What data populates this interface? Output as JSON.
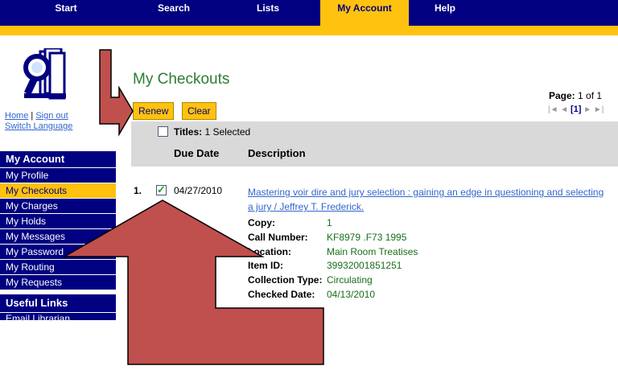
{
  "topnav": {
    "tabs": [
      {
        "label": "Start",
        "active": false
      },
      {
        "label": "Search",
        "active": false
      },
      {
        "label": "Lists",
        "active": false
      },
      {
        "label": "My Account",
        "active": true
      },
      {
        "label": "Help",
        "active": false
      }
    ]
  },
  "toplinks": {
    "home": "Home",
    "sign_out": "Sign out",
    "separator": "|",
    "switch_language": "Switch Language"
  },
  "sidebar": {
    "heading": "My Account",
    "items": [
      {
        "label": "My Profile",
        "active": false
      },
      {
        "label": "My Checkouts",
        "active": true
      },
      {
        "label": "My Charges",
        "active": false
      },
      {
        "label": "My Holds",
        "active": false
      },
      {
        "label": "My Messages",
        "active": false
      },
      {
        "label": "My Password",
        "active": false
      },
      {
        "label": "My Routing",
        "active": false
      },
      {
        "label": "My Requests",
        "active": false
      }
    ],
    "heading2": "Useful Links",
    "links": [
      {
        "label": "Email Librarian"
      }
    ]
  },
  "main": {
    "title": "My Checkouts",
    "renew_label": "Renew",
    "clear_label": "Clear",
    "page_label": "Page:",
    "page_value": "1 of 1",
    "pager_current": "[1]",
    "titles_label": "Titles:",
    "titles_selected": "1 Selected",
    "col_due": "Due Date",
    "col_desc": "Description"
  },
  "checkouts": [
    {
      "num": "1.",
      "checked": true,
      "due_date": "04/27/2010",
      "description": "Mastering voir dire and jury selection : gaining an edge in questioning and selecting a jury / Jeffrey T. Frederick.",
      "details": [
        {
          "key": "Copy:",
          "value": "1"
        },
        {
          "key": "Call Number:",
          "value": "KF8979 .F73 1995"
        },
        {
          "key": "Location:",
          "value": "Main Room Treatises"
        },
        {
          "key": "Item ID:",
          "value": "39932001851251"
        },
        {
          "key": "Collection Type:",
          "value": "Circulating"
        },
        {
          "key": "Checked Date:",
          "value": "04/13/2010"
        }
      ]
    }
  ],
  "colors": {
    "nav_blue": "#000080",
    "gold": "#ffc20e",
    "title_green": "#2e7d32",
    "link_blue": "#3366cc",
    "arrow_red": "#c0504d"
  },
  "icons": [
    "library-logo-icon",
    "checkbox-icon",
    "pager-first-icon",
    "pager-prev-icon",
    "pager-next-icon",
    "pager-last-icon",
    "annotation-arrow"
  ]
}
